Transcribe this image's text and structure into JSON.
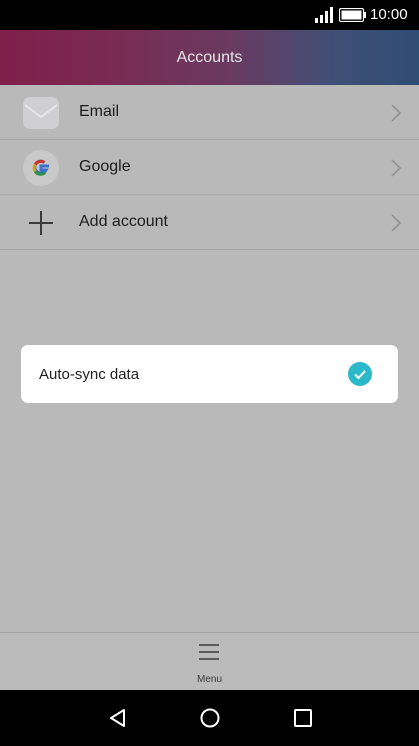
{
  "status_bar": {
    "time": "10:00",
    "icons": [
      "signal-icon",
      "battery-icon"
    ]
  },
  "header": {
    "title": "Accounts"
  },
  "accounts": [
    {
      "label": "Email",
      "icon": "email-icon"
    },
    {
      "label": "Google",
      "icon": "google-icon"
    },
    {
      "label": "Add account",
      "icon": "plus-icon"
    }
  ],
  "dialog": {
    "label": "Auto-sync data",
    "checked": true,
    "accent_color": "#2bb8c8"
  },
  "bottom_menu": {
    "label": "Menu",
    "icon": "menu-icon"
  },
  "nav_bar": {
    "buttons": [
      "back-icon",
      "home-icon",
      "recents-icon"
    ]
  }
}
